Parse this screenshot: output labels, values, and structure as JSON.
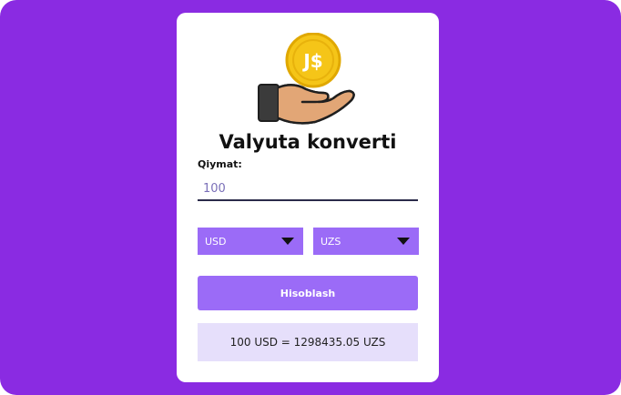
{
  "app": {
    "title": "Valyuta konverti",
    "coin_text": "J$"
  },
  "form": {
    "amount_label": "Qiymat:",
    "amount_value": "100",
    "from_currency": "USD",
    "to_currency": "UZS",
    "button_label": "Hisoblash"
  },
  "result": {
    "text": "100 USD = 1298435.05 UZS"
  },
  "colors": {
    "background": "#8a2be2",
    "accent": "#9b6bf7",
    "result_bg": "#e6dffb",
    "coin": "#f5c518"
  },
  "icons": {
    "illustration": "hand-holding-coin-icon",
    "select_caret": "caret-down-icon"
  }
}
